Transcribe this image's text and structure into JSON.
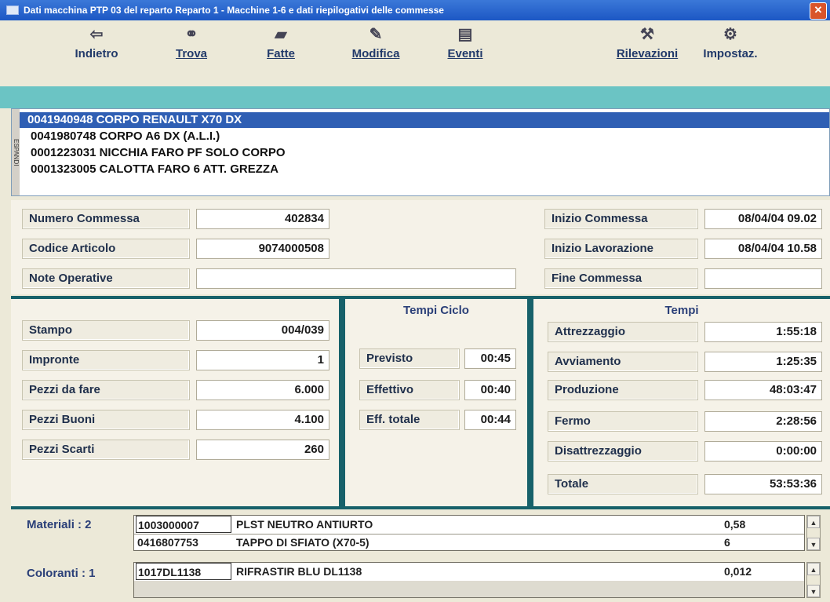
{
  "window": {
    "title": "Dati macchina PTP 03 del reparto Reparto 1 - Macchine 1-6 e dati riepilogativi delle commesse"
  },
  "toolbar": {
    "back": "Indietro",
    "find": "Trova",
    "done": "Fatte",
    "edit": "Modifica",
    "events": "Eventi",
    "surveys": "Rilevazioni",
    "settings": "Impostaz."
  },
  "orders": {
    "side_label": "ESPANDI",
    "items": [
      "0041940948 CORPO RENAULT X70 DX",
      "0041980748 CORPO A6 DX (A.L.I.)",
      "0001223031 NICCHIA FARO PF SOLO CORPO",
      "0001323005 CALOTTA FARO 6 ATT. GREZZA"
    ]
  },
  "order_info": {
    "numero_commessa_label": "Numero Commessa",
    "numero_commessa": "402834",
    "codice_articolo_label": "Codice Articolo",
    "codice_articolo": "9074000508",
    "note_label": "Note Operative",
    "note": "",
    "inizio_commessa_label": "Inizio Commessa",
    "inizio_commessa": "08/04/04 09.02",
    "inizio_lavorazione_label": "Inizio Lavorazione",
    "inizio_lavorazione": "08/04/04 10.58",
    "fine_commessa_label": "Fine Commessa",
    "fine_commessa": ""
  },
  "production": {
    "stampo_label": "Stampo",
    "stampo": "004/039",
    "impronte_label": "Impronte",
    "impronte": "1",
    "pezzi_fare_label": "Pezzi da fare",
    "pezzi_fare": "6.000",
    "pezzi_buoni_label": "Pezzi Buoni",
    "pezzi_buoni": "4.100",
    "pezzi_scarti_label": "Pezzi Scarti",
    "pezzi_scarti": "260"
  },
  "cycle": {
    "title": "Tempi Ciclo",
    "previsto_label": "Previsto",
    "previsto": "00:45",
    "effettivo_label": "Effettivo",
    "effettivo": "00:40",
    "totale_label": "Eff. totale",
    "totale": "00:44"
  },
  "times": {
    "title": "Tempi",
    "attrezzaggio_label": "Attrezzaggio",
    "attrezzaggio": "1:55:18",
    "avviamento_label": "Avviamento",
    "avviamento": "1:25:35",
    "produzione_label": "Produzione",
    "produzione": "48:03:47",
    "fermo_label": "Fermo",
    "fermo": "2:28:56",
    "disattrezzaggio_label": "Disattrezzaggio",
    "disattrezzaggio": "0:00:00",
    "totale_label": "Totale",
    "totale": "53:53:36"
  },
  "materials": {
    "label": "Materiali : 2",
    "rows": [
      {
        "code": "1003000007",
        "name": "PLST NEUTRO ANTIURTO",
        "qty": "0,58"
      },
      {
        "code": "0416807753",
        "name": "TAPPO DI SFIATO  (X70-5)",
        "qty": "6"
      }
    ]
  },
  "colorants": {
    "label": "Coloranti : 1",
    "rows": [
      {
        "code": "1017DL1138",
        "name": "RIFRASTIR BLU DL1138",
        "qty": "0,012"
      }
    ]
  }
}
